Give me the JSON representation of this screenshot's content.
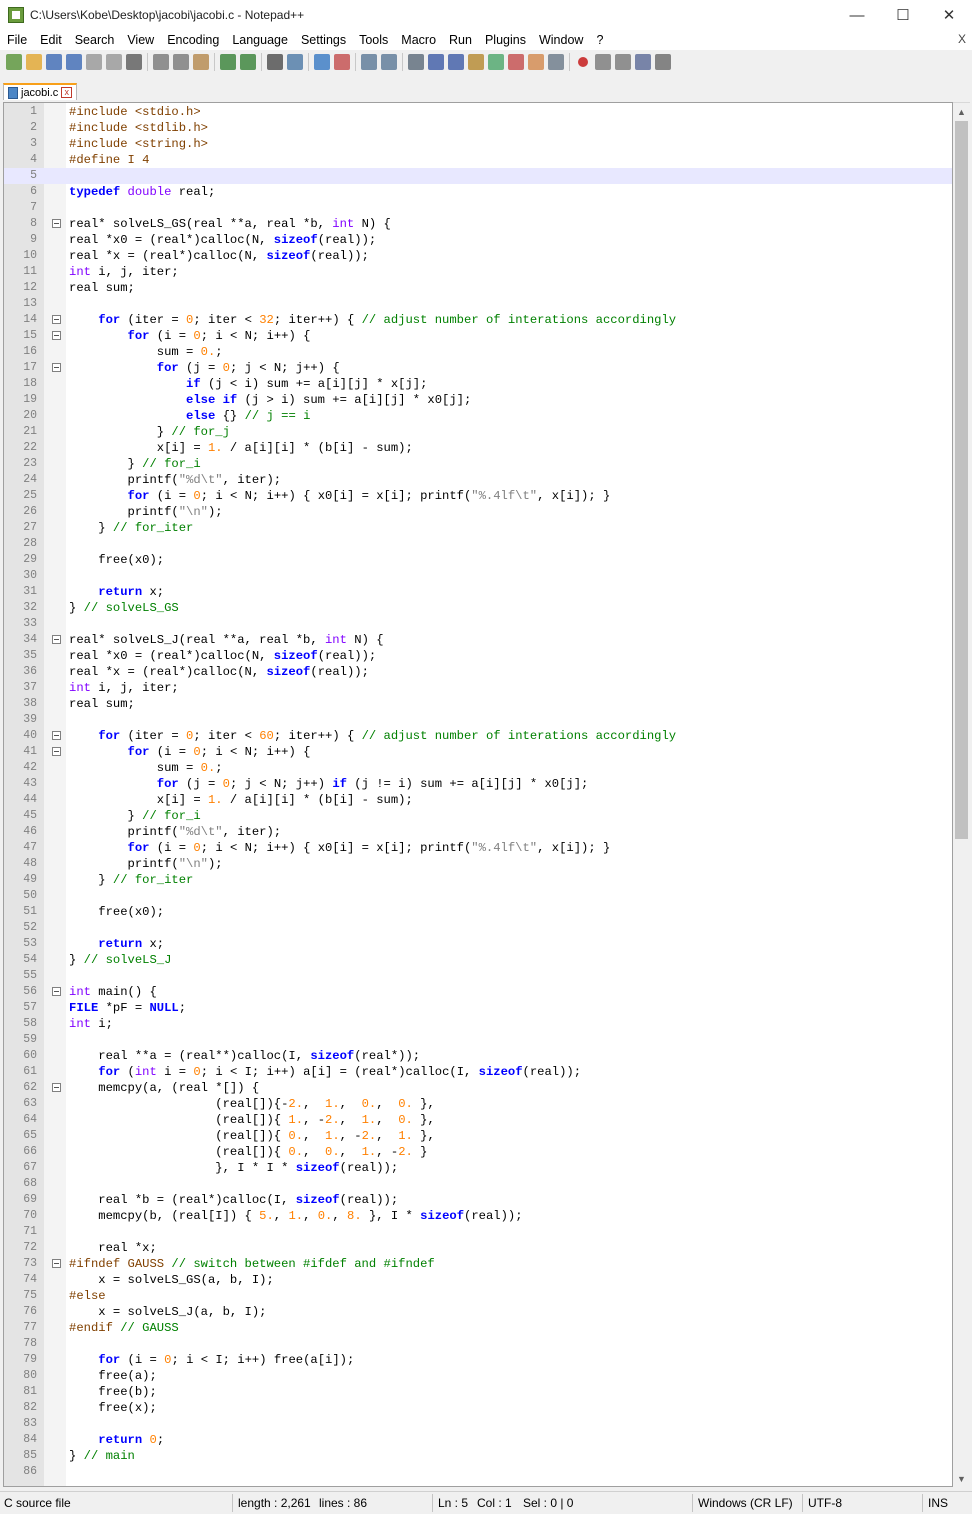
{
  "window": {
    "title": "C:\\Users\\Kobe\\Desktop\\jacobi\\jacobi.c - Notepad++",
    "minimize_glyph": "—",
    "maximize_glyph": "☐",
    "close_glyph": "✕"
  },
  "menu": {
    "items": [
      "File",
      "Edit",
      "Search",
      "View",
      "Encoding",
      "Language",
      "Settings",
      "Tools",
      "Macro",
      "Run",
      "Plugins",
      "Window",
      "?"
    ],
    "close_glyph": "X"
  },
  "toolbar": {
    "buttons": [
      "new-file-icon",
      "open-file-icon",
      "save-icon",
      "save-all-icon",
      "close-icon",
      "close-all-icon",
      "print-icon",
      "cut-icon",
      "copy-icon",
      "paste-icon",
      "undo-icon",
      "redo-icon",
      "find-icon",
      "replace-icon",
      "zoom-in-icon",
      "zoom-out-icon",
      "sync-vertical-icon",
      "sync-horizontal-icon",
      "word-wrap-icon",
      "show-all-chars-icon",
      "indent-guide-icon",
      "user-lang-icon",
      "doc-map-icon",
      "function-list-icon",
      "folder-workspace-icon",
      "monitoring-icon",
      "record-macro-icon",
      "stop-record-icon",
      "play-macro-icon",
      "run-macro-multiple-icon",
      "save-macro-icon"
    ]
  },
  "tab": {
    "label": "jacobi.c",
    "close_glyph": "x"
  },
  "editor": {
    "current_line": 5,
    "lines": [
      "<span class=\"pp\">#include &lt;stdio.h&gt;</span>",
      "<span class=\"pp\">#include &lt;stdlib.h&gt;</span>",
      "<span class=\"pp\">#include &lt;string.h&gt;</span>",
      "<span class=\"pp\">#define I 4</span>",
      "",
      "<span class=\"kw\">typedef</span> <span class=\"ty\">double</span> real;",
      "",
      "real* solveLS_GS(real **a, real *b, <span class=\"ty\">int</span> N) {",
      "real *x0 = (real*)calloc(N, <span class=\"kw\">sizeof</span>(real));",
      "real *x = (real*)calloc(N, <span class=\"kw\">sizeof</span>(real));",
      "<span class=\"ty\">int</span> i, j, iter;",
      "real sum;",
      "",
      "    <span class=\"kw\">for</span> (iter = <span class=\"num\">0</span>; iter &lt; <span class=\"num\">32</span>; iter++) { <span class=\"cmt\">// adjust number of interations accordingly</span>",
      "        <span class=\"kw\">for</span> (i = <span class=\"num\">0</span>; i &lt; N; i++) {",
      "            sum = <span class=\"num\">0.</span>;",
      "            <span class=\"kw\">for</span> (j = <span class=\"num\">0</span>; j &lt; N; j++) {",
      "                <span class=\"kw\">if</span> (j &lt; i) sum += a[i][j] * x[j];",
      "                <span class=\"kw\">else if</span> (j &gt; i) sum += a[i][j] * x0[j];",
      "                <span class=\"kw\">else</span> {} <span class=\"cmt\">// j == i</span>",
      "            } <span class=\"cmt\">// for_j</span>",
      "            x[i] = <span class=\"num\">1.</span> / a[i][i] * (b[i] - sum);",
      "        } <span class=\"cmt\">// for_i</span>",
      "        printf(<span class=\"str\">\"%d\\t\"</span>, iter);",
      "        <span class=\"kw\">for</span> (i = <span class=\"num\">0</span>; i &lt; N; i++) { x0[i] = x[i]; printf(<span class=\"str\">\"%.4lf\\t\"</span>, x[i]); }",
      "        printf(<span class=\"str\">\"\\n\"</span>);",
      "    } <span class=\"cmt\">// for_iter</span>",
      "",
      "    free(x0);",
      "",
      "    <span class=\"kw\">return</span> x;",
      "} <span class=\"cmt\">// solveLS_GS</span>",
      "",
      "real* solveLS_J(real **a, real *b, <span class=\"ty\">int</span> N) {",
      "real *x0 = (real*)calloc(N, <span class=\"kw\">sizeof</span>(real));",
      "real *x = (real*)calloc(N, <span class=\"kw\">sizeof</span>(real));",
      "<span class=\"ty\">int</span> i, j, iter;",
      "real sum;",
      "",
      "    <span class=\"kw\">for</span> (iter = <span class=\"num\">0</span>; iter &lt; <span class=\"num\">60</span>; iter++) { <span class=\"cmt\">// adjust number of interations accordingly</span>",
      "        <span class=\"kw\">for</span> (i = <span class=\"num\">0</span>; i &lt; N; i++) {",
      "            sum = <span class=\"num\">0.</span>;",
      "            <span class=\"kw\">for</span> (j = <span class=\"num\">0</span>; j &lt; N; j++) <span class=\"kw\">if</span> (j != i) sum += a[i][j] * x0[j];",
      "            x[i] = <span class=\"num\">1.</span> / a[i][i] * (b[i] - sum);",
      "        } <span class=\"cmt\">// for_i</span>",
      "        printf(<span class=\"str\">\"%d\\t\"</span>, iter);",
      "        <span class=\"kw\">for</span> (i = <span class=\"num\">0</span>; i &lt; N; i++) { x0[i] = x[i]; printf(<span class=\"str\">\"%.4lf\\t\"</span>, x[i]); }",
      "        printf(<span class=\"str\">\"\\n\"</span>);",
      "    } <span class=\"cmt\">// for_iter</span>",
      "",
      "    free(x0);",
      "",
      "    <span class=\"kw\">return</span> x;",
      "} <span class=\"cmt\">// solveLS_J</span>",
      "",
      "<span class=\"ty\">int</span> main() {",
      "<span class=\"kw\">FILE</span> *pF = <span class=\"kw\">NULL</span>;",
      "<span class=\"ty\">int</span> i;",
      "",
      "    real **a = (real**)calloc(I, <span class=\"kw\">sizeof</span>(real*));",
      "    <span class=\"kw\">for</span> (<span class=\"ty\">int</span> i = <span class=\"num\">0</span>; i &lt; I; i++) a[i] = (real*)calloc(I, <span class=\"kw\">sizeof</span>(real));",
      "    memcpy(a, (real *[]) {",
      "                    (real[]){-<span class=\"num\">2.</span>,  <span class=\"num\">1.</span>,  <span class=\"num\">0.</span>,  <span class=\"num\">0.</span> },",
      "                    (real[]){ <span class=\"num\">1.</span>, -<span class=\"num\">2.</span>,  <span class=\"num\">1.</span>,  <span class=\"num\">0.</span> },",
      "                    (real[]){ <span class=\"num\">0.</span>,  <span class=\"num\">1.</span>, -<span class=\"num\">2.</span>,  <span class=\"num\">1.</span> },",
      "                    (real[]){ <span class=\"num\">0.</span>,  <span class=\"num\">0.</span>,  <span class=\"num\">1.</span>, -<span class=\"num\">2.</span> }",
      "                    }, I * I * <span class=\"kw\">sizeof</span>(real));",
      "",
      "    real *b = (real*)calloc(I, <span class=\"kw\">sizeof</span>(real));",
      "    memcpy(b, (real[I]) { <span class=\"num\">5.</span>, <span class=\"num\">1.</span>, <span class=\"num\">0.</span>, <span class=\"num\">8.</span> }, I * <span class=\"kw\">sizeof</span>(real));",
      "",
      "    real *x;",
      "<span class=\"pp\">#ifndef GAUSS</span> <span class=\"cmt\">// switch between #ifdef and #ifndef</span>",
      "    x = solveLS_GS(a, b, I);",
      "<span class=\"pp\">#else</span>",
      "    x = solveLS_J(a, b, I);",
      "<span class=\"pp\">#endif</span> <span class=\"cmt\">// GAUSS</span>",
      "",
      "    <span class=\"kw\">for</span> (i = <span class=\"num\">0</span>; i &lt; I; i++) free(a[i]);",
      "    free(a);",
      "    free(b);",
      "    free(x);",
      "",
      "    <span class=\"kw\">return</span> <span class=\"num\">0</span>;",
      "} <span class=\"cmt\">// main</span>",
      ""
    ],
    "fold_lines": [
      8,
      14,
      15,
      17,
      34,
      40,
      41,
      56,
      62,
      73
    ]
  },
  "scrollbar": {
    "up_glyph": "▲",
    "down_glyph": "▼"
  },
  "status": {
    "filetype": "C source file",
    "length": "length : 2,261",
    "lines": "lines : 86",
    "ln": "Ln : 5",
    "col": "Col : 1",
    "sel": "Sel : 0 | 0",
    "eol": "Windows (CR LF)",
    "encoding": "UTF-8",
    "mode": "INS"
  },
  "colors": {
    "keyword": "#0000ff",
    "type": "#8000ff",
    "number": "#ff8000",
    "string": "#808080",
    "comment": "#008000",
    "preprocessor": "#804000",
    "current_line": "#e8e8ff",
    "tab_accent": "#f8a01a"
  }
}
